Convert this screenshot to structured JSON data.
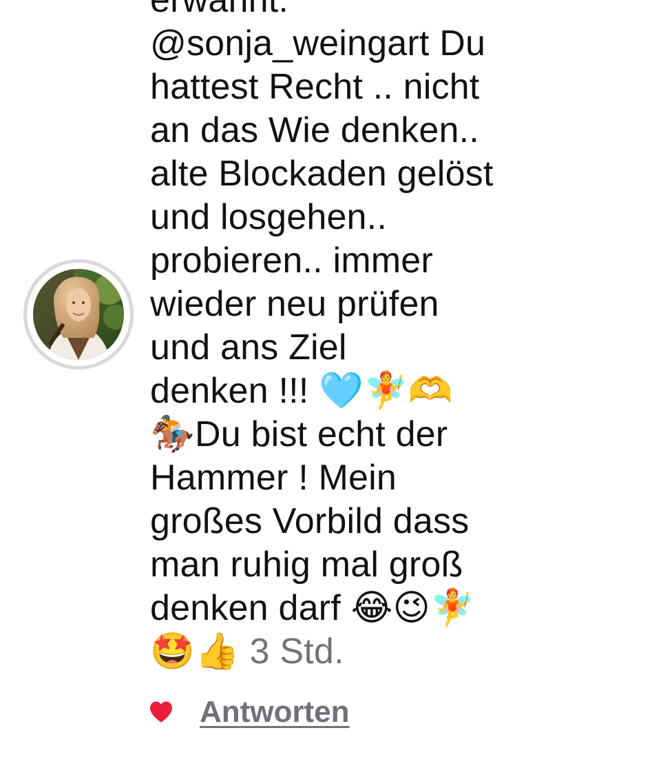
{
  "comment": {
    "text_lines": "erwähnt:\n@sonja_weingart Du\nhattest Recht .. nicht\nan das Wie denken..\nalte Blockaden gelöst\nund losgehen..\nprobieren.. immer\nwieder neu prüfen\nund ans Ziel\ndenken !!! 🩵🧚🫶\n🏇Du bist echt der\nHammer ! Mein\ngroßes Vorbild dass\nman ruhig mal groß\ndenken darf 😂😉🧚\n🤩👍",
    "timestamp": " 3 Std."
  },
  "actions": {
    "like_icon": "heart-icon",
    "like_color": "#ed1d3c",
    "reply_label": "Antworten"
  },
  "colors": {
    "text": "#111111",
    "timestamp": "#737373",
    "reply": "#6e7178",
    "avatar_ring": "#d9d9d9"
  }
}
